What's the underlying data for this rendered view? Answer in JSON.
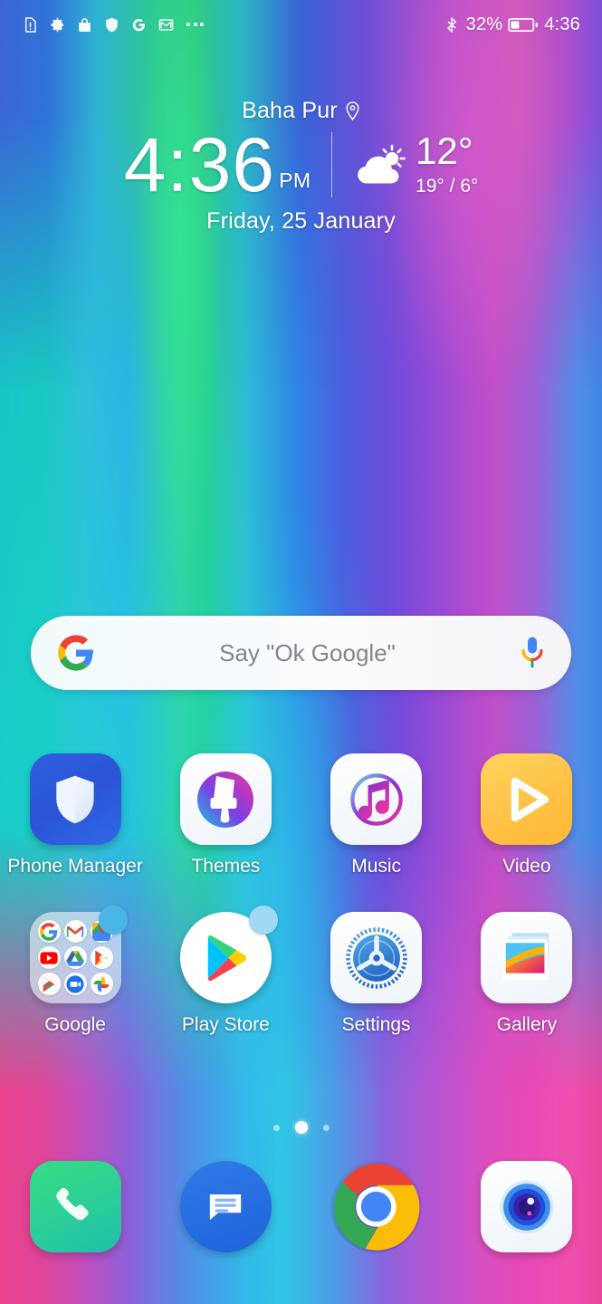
{
  "status_bar": {
    "left_icons": [
      {
        "name": "document-alert-icon"
      },
      {
        "name": "gear-icon"
      },
      {
        "name": "bag-icon"
      },
      {
        "name": "shield-icon"
      },
      {
        "name": "google-icon"
      },
      {
        "name": "gmail-icon"
      },
      {
        "name": "more-dots-icon"
      }
    ],
    "bluetooth_icon": "bluetooth-icon",
    "battery_percent": "32%",
    "battery_icon": "battery-icon",
    "clock": "4:36"
  },
  "widget": {
    "location": "Baha Pur",
    "location_pin_icon": "location-pin-icon",
    "time": "4:36",
    "meridiem": "PM",
    "weather_icon": "partly-cloudy-icon",
    "temperature": "12°",
    "high_low": "19° / 6°",
    "date": "Friday, 25 January"
  },
  "search": {
    "google_logo_icon": "google-logo-icon",
    "placeholder": "Say \"Ok Google\"",
    "mic_icon": "microphone-icon"
  },
  "apps": {
    "row1": [
      {
        "label": "Phone Manager",
        "icon": "phone-manager-icon",
        "badge": false
      },
      {
        "label": "Themes",
        "icon": "themes-icon",
        "badge": false
      },
      {
        "label": "Music",
        "icon": "music-icon",
        "badge": false
      },
      {
        "label": "Video",
        "icon": "video-icon",
        "badge": false
      }
    ],
    "row2": [
      {
        "label": "Google",
        "icon": "google-folder-icon",
        "badge": true
      },
      {
        "label": "Play Store",
        "icon": "play-store-icon",
        "badge": true
      },
      {
        "label": "Settings",
        "icon": "settings-icon",
        "badge": false
      },
      {
        "label": "Gallery",
        "icon": "gallery-icon",
        "badge": false
      }
    ]
  },
  "google_folder": {
    "items": [
      {
        "name": "google-search-mini-icon"
      },
      {
        "name": "gmail-mini-icon"
      },
      {
        "name": "maps-mini-icon"
      },
      {
        "name": "youtube-mini-icon"
      },
      {
        "name": "drive-mini-icon"
      },
      {
        "name": "play-music-mini-icon"
      },
      {
        "name": "play-movies-mini-icon"
      },
      {
        "name": "duo-mini-icon"
      },
      {
        "name": "photos-mini-icon"
      }
    ]
  },
  "page_indicator": {
    "total": 3,
    "active": 2
  },
  "dock": [
    {
      "name": "phone-dock-icon"
    },
    {
      "name": "messages-dock-icon"
    },
    {
      "name": "chrome-dock-icon"
    },
    {
      "name": "camera-dock-icon"
    }
  ],
  "colors": {
    "accent_blue": "#4ab6e8",
    "google_blue": "#4285F4",
    "google_red": "#EA4335",
    "google_yellow": "#FBBC05",
    "google_green": "#34A853",
    "phone_green": "#2ed193",
    "messages_blue": "#2f7ae8",
    "video_yellow": "#ffc246"
  }
}
